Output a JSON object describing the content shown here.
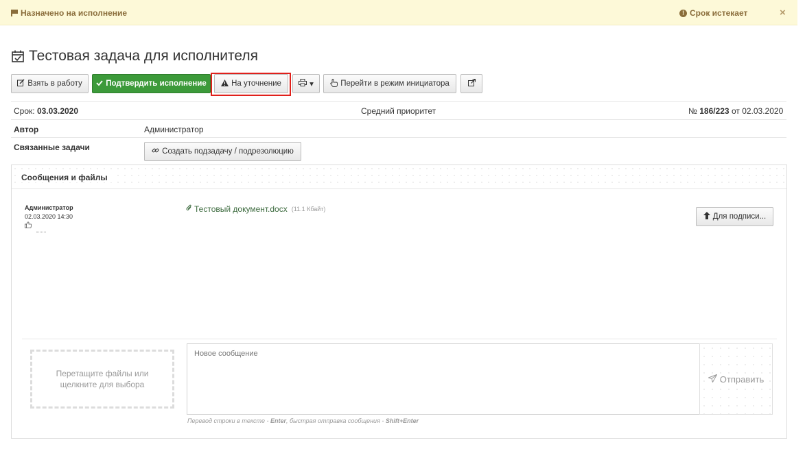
{
  "topbar": {
    "status": "Назначено на исполнение",
    "deadline_warning": "Срок истекает",
    "close_symbol": "×"
  },
  "task": {
    "title": "Тестовая задача для исполнителя"
  },
  "toolbar": {
    "take_label": "Взять в работу",
    "confirm_label": "Подтвердить исполнение",
    "clarify_label": "На уточнение",
    "print_caret": "▾",
    "initiator_label": "Перейти в режим инициатора",
    "accent_green": "#3c9a3a",
    "highlight_color": "#e0201b"
  },
  "meta": {
    "deadline_label": "Срок:",
    "deadline_value": "03.03.2020",
    "priority": "Средний приоритет",
    "number_prefix": "№",
    "number_value": "186/223",
    "number_suffix": "от 02.03.2020"
  },
  "fields": {
    "author_label": "Автор",
    "author_value": "Администратор",
    "related_label": "Связанные задачи",
    "create_subtask_label": "Создать подзадачу / подрезолюцию"
  },
  "messages": {
    "header": "Сообщения и файлы",
    "items": [
      {
        "author": "Администратор",
        "date": "02.03.2020 14:30",
        "attachment_name": "Тестовый документ.docx",
        "attachment_size": "(11.1 Кбайт)",
        "action_label": "Для подписи..."
      }
    ]
  },
  "composer": {
    "dropzone_line1": "Перетащите файлы или",
    "dropzone_line2": "щелкните для выбора",
    "placeholder": "Новое сообщение",
    "send_label": "Отправить",
    "hint_text1": "Перевод строки в тексте - ",
    "hint_key1": "Enter",
    "hint_text2": ", быстрая отправка сообщения - ",
    "hint_key2": "Shift+Enter"
  }
}
